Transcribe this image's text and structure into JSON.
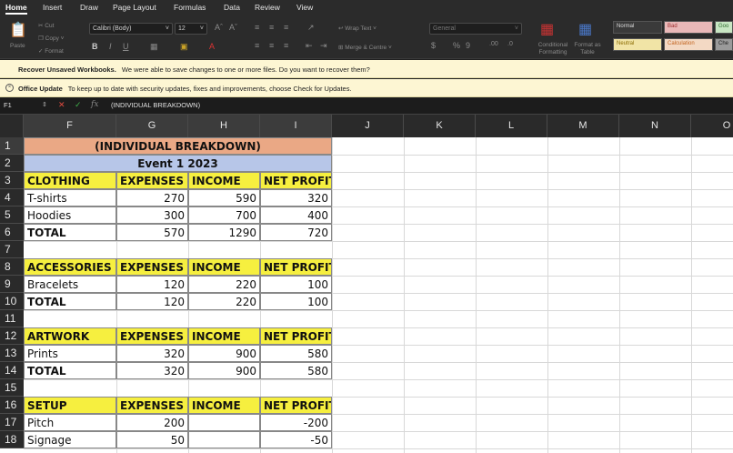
{
  "menu": {
    "tabs": [
      "Home",
      "Insert",
      "Draw",
      "Page Layout",
      "Formulas",
      "Data",
      "Review",
      "View"
    ]
  },
  "ribbon": {
    "paste": "Paste",
    "cut": "Cut",
    "copy": "Copy",
    "format": "Format",
    "font_name": "Calibri (Body)",
    "font_size": "12",
    "wrap_text": "Wrap Text",
    "merge_center": "Merge & Centre",
    "number_format": "General",
    "conditional_formatting": "Conditional Formatting",
    "format_as_table": "Format as Table",
    "styles": {
      "normal": "Normal",
      "bad": "Bad",
      "good": "Goo",
      "neutral": "Neutral",
      "calculation": "Calculation",
      "check": "Che"
    }
  },
  "messages": {
    "recover_title": "Recover Unsaved Workbooks.",
    "recover_text": "We were able to save changes to one or more files. Do you want to recover them?",
    "update_title": "Office Update",
    "update_text": "To keep up to date with security updates, fixes and improvements, choose Check for Updates."
  },
  "formula_bar": {
    "name_box": "F1",
    "content": "(INDIVIDUAL BREAKDOWN)"
  },
  "grid": {
    "columns": [
      "F",
      "G",
      "H",
      "I",
      "J",
      "K",
      "L",
      "M",
      "N",
      "O"
    ],
    "rows": [
      "1",
      "2",
      "3",
      "4",
      "5",
      "6",
      "7",
      "8",
      "9",
      "10",
      "11",
      "12",
      "13",
      "14",
      "15",
      "16",
      "17",
      "18"
    ],
    "title": "(INDIVIDUAL BREAKDOWN)",
    "event": "Event 1 2023",
    "headers": {
      "expenses": "EXPENSES",
      "income": "INCOME",
      "net_profit": "NET PROFIT"
    },
    "sections": {
      "clothing": {
        "label": "CLOTHING",
        "rows": [
          {
            "item": "T-shirts",
            "expenses": "270",
            "income": "590",
            "net": "320"
          },
          {
            "item": "Hoodies",
            "expenses": "300",
            "income": "700",
            "net": "400"
          },
          {
            "item": "TOTAL",
            "expenses": "570",
            "income": "1290",
            "net": "720"
          }
        ]
      },
      "accessories": {
        "label": "ACCESSORIES",
        "rows": [
          {
            "item": "Bracelets",
            "expenses": "120",
            "income": "220",
            "net": "100"
          },
          {
            "item": "TOTAL",
            "expenses": "120",
            "income": "220",
            "net": "100"
          }
        ]
      },
      "artwork": {
        "label": "ARTWORK",
        "rows": [
          {
            "item": "Prints",
            "expenses": "320",
            "income": "900",
            "net": "580"
          },
          {
            "item": "TOTAL",
            "expenses": "320",
            "income": "900",
            "net": "580"
          }
        ]
      },
      "setup": {
        "label": "SETUP",
        "rows": [
          {
            "item": "Pitch",
            "expenses": "200",
            "income": "",
            "net": "-200"
          },
          {
            "item": "Signage",
            "expenses": "50",
            "income": "",
            "net": "-50"
          }
        ]
      }
    }
  }
}
